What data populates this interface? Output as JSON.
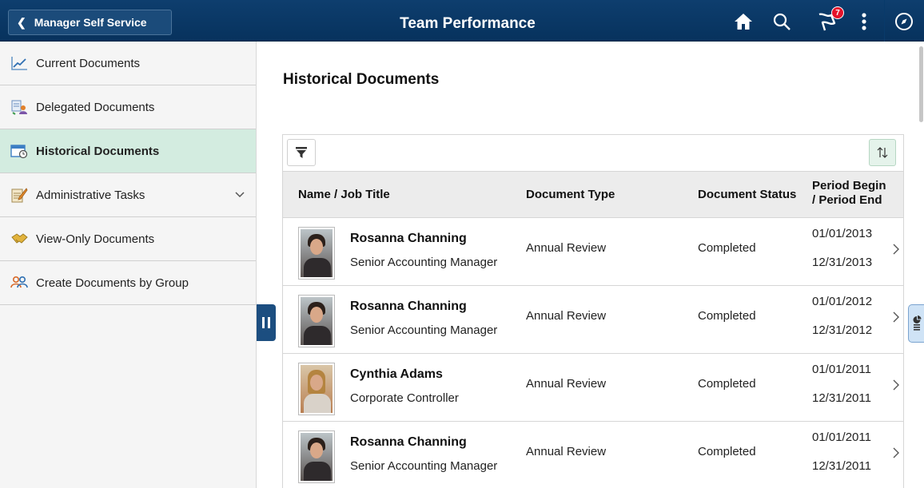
{
  "header": {
    "back_label": "Manager Self Service",
    "title": "Team Performance",
    "notification_count": "7",
    "icons": [
      "home-icon",
      "search-icon",
      "flag-icon",
      "actions-icon",
      "navbar-icon"
    ]
  },
  "sidebar": {
    "items": [
      {
        "label": "Current Documents",
        "icon": "line-chart-icon"
      },
      {
        "label": "Delegated Documents",
        "icon": "delegate-icon"
      },
      {
        "label": "Historical Documents",
        "icon": "calendar-clock-icon",
        "active": true
      },
      {
        "label": "Administrative Tasks",
        "icon": "notepad-pencil-icon",
        "expandable": true
      },
      {
        "label": "View-Only Documents",
        "icon": "handshake-icon"
      },
      {
        "label": "Create Documents by Group",
        "icon": "group-icon"
      }
    ]
  },
  "main": {
    "page_title": "Historical Documents",
    "columns": {
      "name": "Name / Job Title",
      "doc_type": "Document Type",
      "doc_status": "Document Status",
      "period_line1": "Period Begin",
      "period_line2": "/ Period End"
    },
    "rows": [
      {
        "name": "Rosanna Channing",
        "job": "Senior Accounting Manager",
        "doc_type": "Annual Review",
        "status": "Completed",
        "begin": "01/01/2013",
        "end": "12/31/2013"
      },
      {
        "name": "Rosanna Channing",
        "job": "Senior Accounting Manager",
        "doc_type": "Annual Review",
        "status": "Completed",
        "begin": "01/01/2012",
        "end": "12/31/2012"
      },
      {
        "name": "Cynthia Adams",
        "job": "Corporate Controller",
        "doc_type": "Annual Review",
        "status": "Completed",
        "begin": "01/01/2011",
        "end": "12/31/2011"
      },
      {
        "name": "Rosanna Channing",
        "job": "Senior Accounting Manager",
        "doc_type": "Annual Review",
        "status": "Completed",
        "begin": "01/01/2011",
        "end": "12/31/2011"
      }
    ]
  },
  "colors": {
    "header_bg": "#0b3a68",
    "active_item_bg": "#d3ece0",
    "badge": "#e5122a"
  }
}
